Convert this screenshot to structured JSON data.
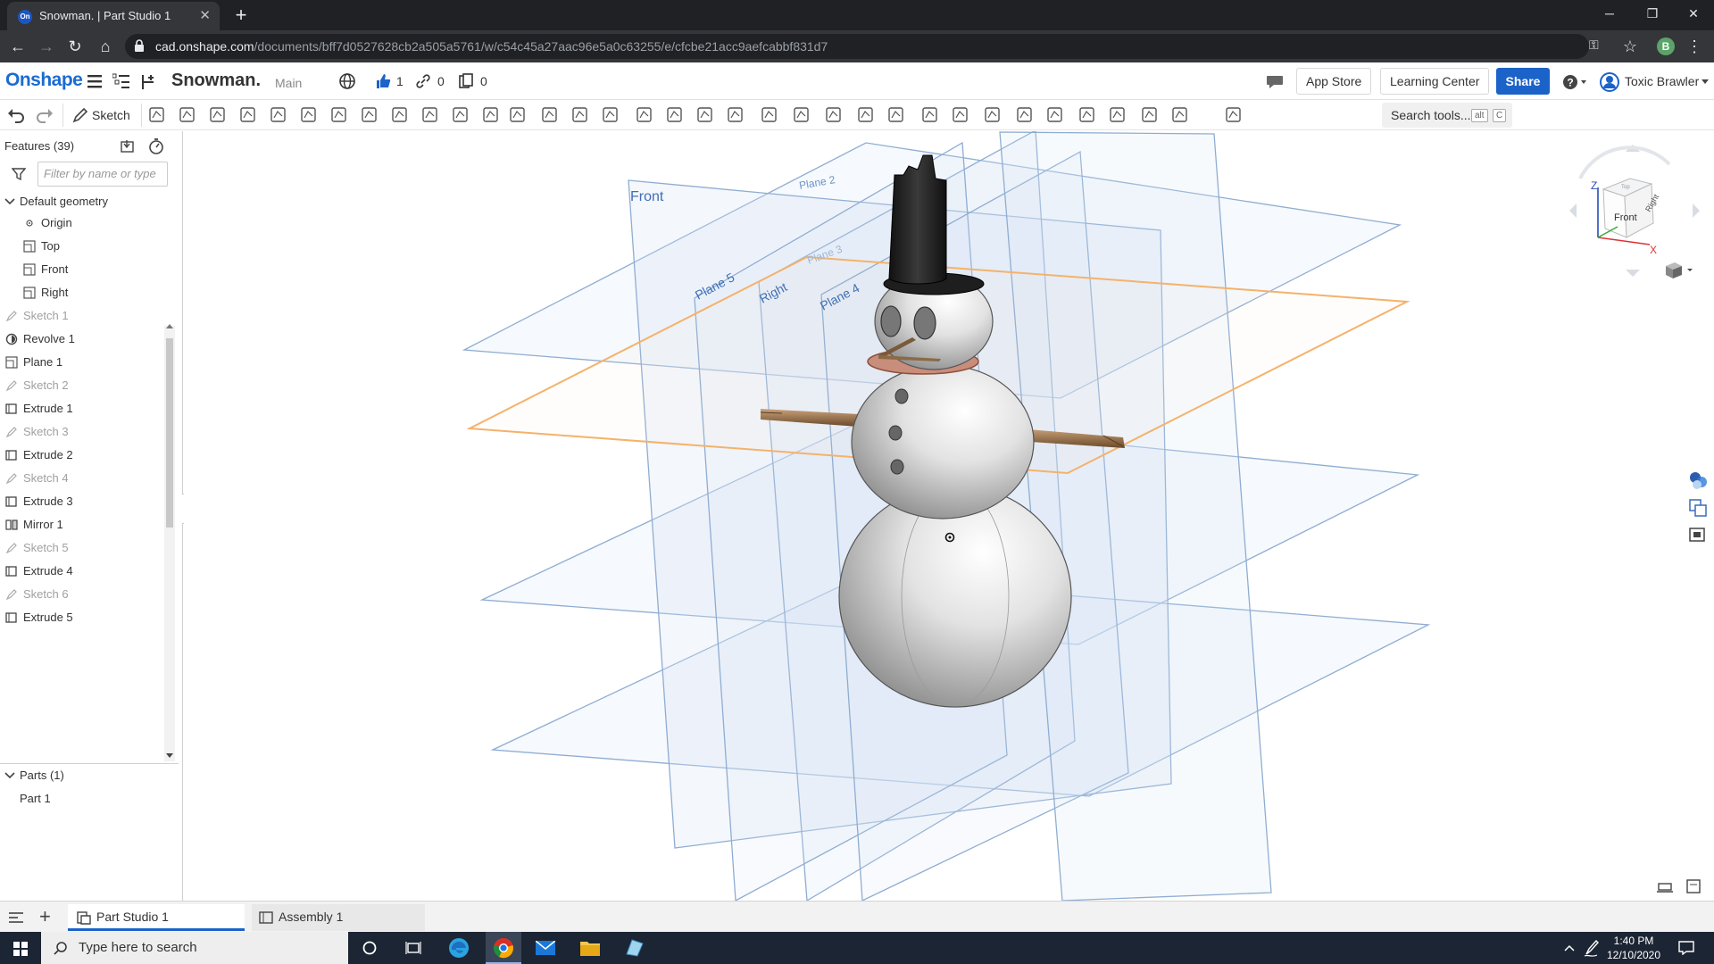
{
  "browser": {
    "tab_title": "Snowman. | Part Studio 1",
    "favicon_text": "On",
    "url_host": "cad.onshape.com",
    "url_path": "/documents/bff7d0527628cb2a505a5761/w/c54c45a27aac96e5a0c63255/e/cfcbe21acc9aefcabbf831d7",
    "profile_initial": "B"
  },
  "header": {
    "logo": "Onshape",
    "doc_name": "Snowman.",
    "branch": "Main",
    "likes": "1",
    "links": "0",
    "copies": "0",
    "app_store": "App Store",
    "learning_center": "Learning Center",
    "share": "Share",
    "user": "Toxic Brawler"
  },
  "toolbar": {
    "sketch_label": "Sketch",
    "search_tools": "Search tools...",
    "search_kbd_1": "alt",
    "search_kbd_2": "C"
  },
  "features": {
    "title": "Features (39)",
    "filter_placeholder": "Filter by name or type",
    "default_geometry": "Default geometry",
    "items": [
      {
        "label": "Origin"
      },
      {
        "label": "Top"
      },
      {
        "label": "Front"
      },
      {
        "label": "Right"
      },
      {
        "label": "Sketch 1"
      },
      {
        "label": "Revolve 1"
      },
      {
        "label": "Plane 1"
      },
      {
        "label": "Sketch 2"
      },
      {
        "label": "Extrude 1"
      },
      {
        "label": "Sketch 3"
      },
      {
        "label": "Extrude 2"
      },
      {
        "label": "Sketch 4"
      },
      {
        "label": "Extrude 3"
      },
      {
        "label": "Mirror 1"
      },
      {
        "label": "Sketch 5"
      },
      {
        "label": "Extrude 4"
      },
      {
        "label": "Sketch 6"
      },
      {
        "label": "Extrude 5"
      }
    ],
    "parts_title": "Parts (1)",
    "part": "Part 1"
  },
  "viewport": {
    "plane_front": "Front",
    "plane_2": "Plane 2",
    "plane_3": "Plane 3",
    "plane_5": "Plane 5",
    "plane_right": "Right",
    "plane_4": "Plane 4",
    "cube_front": "Front",
    "cube_right": "Right",
    "cube_top": "Top",
    "axis_z": "Z",
    "axis_x": "X"
  },
  "tabs": {
    "part_studio": "Part Studio 1",
    "assembly": "Assembly 1"
  },
  "taskbar": {
    "search": "Type here to search",
    "time": "1:40 PM",
    "date": "12/10/2020"
  }
}
